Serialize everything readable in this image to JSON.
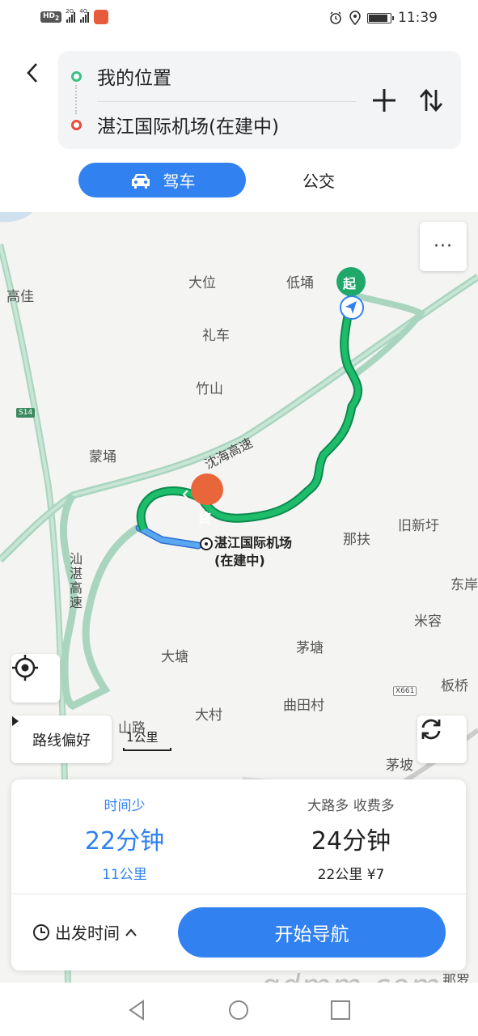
{
  "status_bar": {
    "hd": "HD",
    "hd_sub": "2",
    "sig1_label": "2G",
    "sig2_label": "4G",
    "time": "11:39"
  },
  "route": {
    "origin": "我的位置",
    "destination": "湛江国际机场(在建中)"
  },
  "modes": {
    "drive": "驾车",
    "transit": "公交"
  },
  "map": {
    "places": [
      {
        "name": "高佳"
      },
      {
        "name": "大位"
      },
      {
        "name": "低埇"
      },
      {
        "name": "礼车"
      },
      {
        "name": "竹山"
      },
      {
        "name": "蒙埇"
      },
      {
        "name": "旧新圩"
      },
      {
        "name": "那扶"
      },
      {
        "name": "东岸"
      },
      {
        "name": "米容"
      },
      {
        "name": "大塘"
      },
      {
        "name": "茅塘"
      },
      {
        "name": "板桥"
      },
      {
        "name": "曲田村"
      },
      {
        "name": "山路"
      },
      {
        "name": "大村"
      },
      {
        "name": "茅坡"
      },
      {
        "name": "那罗"
      }
    ],
    "road_highway": "沈海高速",
    "road_highway2": "汕湛高速",
    "road_shield": "X661",
    "road_s14": "S14",
    "start_marker": "起",
    "end_marker": "终",
    "dest_line1": "湛江国际机场",
    "dest_line2": "(在建中)",
    "route_pref": "路线偏好",
    "scale": "1公里",
    "more": "···"
  },
  "options": [
    {
      "tag": "时间少",
      "time": "22分钟",
      "distance": "11公里",
      "toll": ""
    },
    {
      "tag": "大路多 收费多",
      "time": "24分钟",
      "distance": "22公里",
      "toll": "¥7"
    }
  ],
  "depart_time": "出发时间",
  "start_nav": "开始导航",
  "watermark": "gdmm.com",
  "colors": {
    "accent": "#3181f0",
    "route_main": "#1dbd6b",
    "route_alt": "#5aa8f0",
    "highway": "#a9d5bf",
    "start_green": "#1ea86a",
    "end_orange": "#e8663a"
  }
}
